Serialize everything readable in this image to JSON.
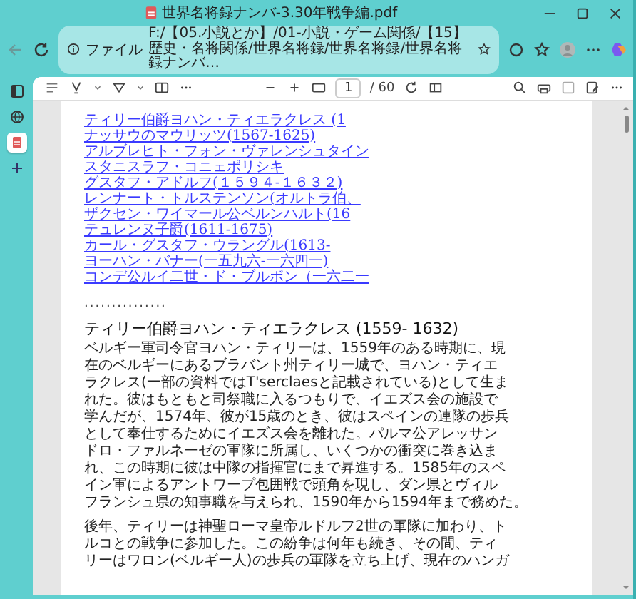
{
  "window": {
    "title": "世界名将録ナンバ-3.30年戦争編.pdf"
  },
  "address_bar": {
    "label": "ファイル",
    "url": "F:/【05.小説とか】/01-小説・ゲーム関係/【15】歴史・名将関係/世界名将録/世界名将録/世界名将録ナンバ…"
  },
  "pdf_toolbar": {
    "page": "1",
    "page_count": "/ 60"
  },
  "sidebar": {
    "items": [
      {
        "kind": "panel",
        "selected": false
      },
      {
        "kind": "globe",
        "selected": false
      },
      {
        "kind": "pdf",
        "selected": true
      },
      {
        "kind": "add",
        "selected": false
      }
    ]
  },
  "document": {
    "links": [
      "ティリー伯爵ヨハン・ティエラクレス (1",
      "ナッサウのマウリッツ(1567-1625)",
      "アルブレヒト・フォン・ヴァレンシュタイン",
      "スタニスラフ・コニェポリシキ",
      "グスタフ・アドルフ(１５９４-１６３２)",
      "レンナート・トルステンソン(オルトラ伯、",
      "ザクセン・ワイマール公ベルンハルト(16",
      "テュレンヌ子爵(1611-1675)",
      "カール・グスタフ・ウラングル(1613-",
      "ヨーハン・バナー(一五九六-一六四一)",
      "コンデ公ルイ二世・ド・ブルボン（一六二一"
    ],
    "separator": "...............",
    "heading": "ティリー伯爵ヨハン・ティエラクレス (1559- 1632)",
    "paragraphs": [
      [
        "ベルギー軍司令官ヨハン・ティリーは、1559年のある時期に、現",
        "在のベルギーにあるブラバント州ティリー城で、ヨハン・ティエ",
        "ラクレス(一部の資料ではT'serclaesと記載されている)として生ま",
        "れた。彼はもともと司祭職に入るつもりで、イエズス会の施設で",
        "学んだが、1574年、彼が15歳のとき、彼はスペインの連隊の歩兵",
        "として奉仕するためにイエズス会を離れた。パルマ公アレッサン",
        "ドロ・ファルネーゼの軍隊に所属し、いくつかの衝突に巻き込ま",
        "れ、この時期に彼は中隊の指揮官にまで昇進する。1585年のスペ",
        "イン軍によるアントワープ包囲戦で頭角を現し、ダン県とヴィル",
        "フランシュ県の知事職を与えられ、1590年から1594年まで務めた。"
      ],
      [
        "後年、ティリーは神聖ローマ皇帝ルドルフ2世の軍隊に加わり、ト",
        "ルコとの戦争に参加した。この紛争は何年も続き、その間、ティ",
        "リーはワロン(ベルギー人)の歩兵の軍隊を立ち上げ、現在のハンガ"
      ]
    ]
  }
}
